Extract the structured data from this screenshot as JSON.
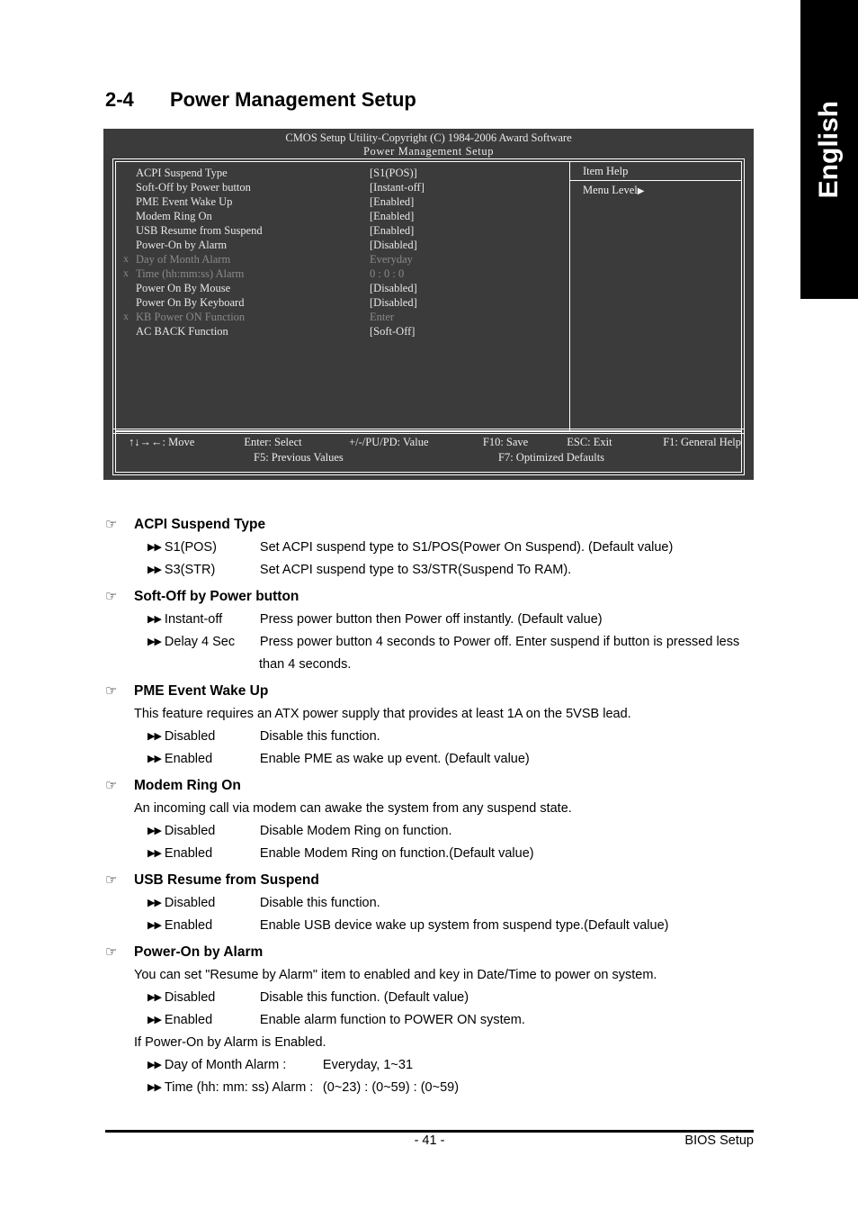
{
  "language_tab": {
    "label": "English"
  },
  "section": {
    "number": "2-4",
    "title": "Power Management Setup"
  },
  "bios_screen": {
    "title_line1": "CMOS Setup Utility-Copyright (C) 1984-2006 Award Software",
    "title_line2": "Power Management Setup",
    "help_panel": {
      "title": "Item Help",
      "menu_level": "Menu Level",
      "menu_level_arrow": "▶"
    },
    "options": [
      {
        "x": "",
        "label": "ACPI Suspend Type",
        "value": "[S1(POS)]",
        "dim": false
      },
      {
        "x": "",
        "label": "Soft-Off by Power button",
        "value": "[Instant-off]",
        "dim": false
      },
      {
        "x": "",
        "label": "PME Event Wake Up",
        "value": "[Enabled]",
        "dim": false
      },
      {
        "x": "",
        "label": "Modem Ring On",
        "value": "[Enabled]",
        "dim": false
      },
      {
        "x": "",
        "label": "USB Resume from Suspend",
        "value": "[Enabled]",
        "dim": false
      },
      {
        "x": "",
        "label": "Power-On by Alarm",
        "value": "[Disabled]",
        "dim": false
      },
      {
        "x": "x",
        "label": "Day of Month Alarm",
        "value": "Everyday",
        "dim": true
      },
      {
        "x": "x",
        "label": "Time (hh:mm:ss) Alarm",
        "value": "0 : 0 : 0",
        "dim": true
      },
      {
        "x": "",
        "label": "Power On By Mouse",
        "value": "[Disabled]",
        "dim": false
      },
      {
        "x": "",
        "label": "Power On By Keyboard",
        "value": "[Disabled]",
        "dim": false
      },
      {
        "x": "x",
        "label": "KB Power ON Function",
        "value": "Enter",
        "dim": true
      },
      {
        "x": "",
        "label": "AC BACK Function",
        "value": "[Soft-Off]",
        "dim": false
      }
    ],
    "footer": {
      "row1": [
        "↑↓→←: Move",
        "Enter: Select",
        "+/-/PU/PD: Value",
        "F10: Save",
        "ESC: Exit",
        "F1: General Help"
      ],
      "row2": [
        "F5: Previous Values",
        "F7: Optimized Defaults"
      ]
    }
  },
  "icons": {
    "hand": "☞",
    "arrows": "▶▶"
  },
  "items": [
    {
      "title": "ACPI Suspend Type",
      "note": "",
      "options": [
        {
          "name": "S1(POS)",
          "desc": "Set ACPI suspend type to S1/POS(Power On Suspend). (Default value)",
          "cont": ""
        },
        {
          "name": "S3(STR)",
          "desc": "Set ACPI suspend type to S3/STR(Suspend To RAM).",
          "cont": ""
        }
      ],
      "after_note": ""
    },
    {
      "title": "Soft-Off by Power button",
      "note": "",
      "options": [
        {
          "name": "Instant-off",
          "desc": "Press power button then Power off instantly. (Default value)",
          "cont": ""
        },
        {
          "name": "Delay 4 Sec",
          "desc": "Press power button 4 seconds to Power off. Enter suspend if button is pressed less",
          "cont": "than 4 seconds."
        }
      ],
      "after_note": ""
    },
    {
      "title": "PME Event Wake Up",
      "note": "This feature requires an ATX power supply that provides at least 1A on the 5VSB lead.",
      "options": [
        {
          "name": "Disabled",
          "desc": "Disable this function.",
          "cont": ""
        },
        {
          "name": "Enabled",
          "desc": "Enable PME as wake up event. (Default value)",
          "cont": ""
        }
      ],
      "after_note": ""
    },
    {
      "title": "Modem Ring On",
      "note": "An incoming call via modem can awake the system from any suspend state.",
      "options": [
        {
          "name": "Disabled",
          "desc": "Disable Modem Ring on function.",
          "cont": ""
        },
        {
          "name": "Enabled",
          "desc": "Enable Modem Ring on function.(Default value)",
          "cont": ""
        }
      ],
      "after_note": ""
    },
    {
      "title": "USB Resume from Suspend",
      "note": "",
      "options": [
        {
          "name": "Disabled",
          "desc": "Disable this function.",
          "cont": ""
        },
        {
          "name": "Enabled",
          "desc": "Enable USB device wake up system from suspend type.(Default value)",
          "cont": ""
        }
      ],
      "after_note": ""
    },
    {
      "title": "Power-On by Alarm",
      "note": "You can set \"Resume by Alarm\" item to enabled and key in Date/Time to power on system.",
      "options": [
        {
          "name": "Disabled",
          "desc": "Disable this function. (Default value)",
          "cont": ""
        },
        {
          "name": "Enabled",
          "desc": "Enable alarm function to POWER ON system.",
          "cont": ""
        }
      ],
      "after_note": "If Power-On by Alarm is Enabled.",
      "extra_options": [
        {
          "name": "Day of Month Alarm :",
          "desc": "Everyday, 1~31"
        },
        {
          "name": "Time (hh: mm: ss) Alarm :",
          "desc": "(0~23) : (0~59) : (0~59)"
        }
      ]
    }
  ],
  "footer": {
    "page_number": "- 41 -",
    "right_label": "BIOS Setup"
  }
}
